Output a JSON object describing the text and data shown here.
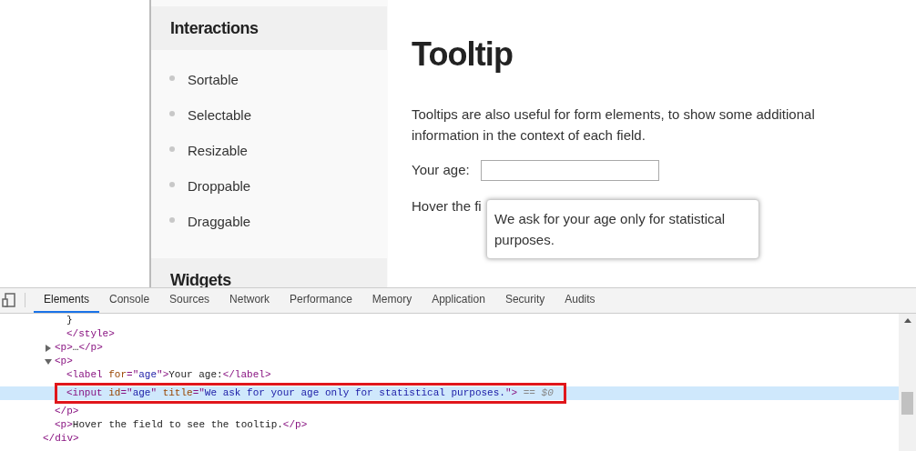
{
  "sidebar": {
    "sections": [
      {
        "title": "Interactions",
        "items": [
          "Sortable",
          "Selectable",
          "Resizable",
          "Droppable",
          "Draggable"
        ]
      },
      {
        "title": "Widgets"
      }
    ]
  },
  "content": {
    "title": "Tooltip",
    "intro": "Tooltips are also useful for form elements, to show some additional information in the context of each field.",
    "field_label": "Your age:",
    "hint": "Hover the fi",
    "tooltip": "We ask for your age only for statistical purposes."
  },
  "devtools": {
    "tabs": [
      {
        "label": "Elements",
        "selected": true
      },
      {
        "label": "Console",
        "selected": false
      },
      {
        "label": "Sources",
        "selected": false
      },
      {
        "label": "Network",
        "selected": false
      },
      {
        "label": "Performance",
        "selected": false
      },
      {
        "label": "Memory",
        "selected": false
      },
      {
        "label": "Application",
        "selected": false
      },
      {
        "label": "Security",
        "selected": false
      },
      {
        "label": "Audits",
        "selected": false
      }
    ],
    "tree": [
      {
        "children": [
          {
            "children": [
              {
                "children": [
                  {
                    "selected": false,
                    "tokens": [
                      {
                        "kind": "text",
                        "text": "}"
                      }
                    ]
                  },
                  {
                    "selected": false,
                    "tokens": [
                      {
                        "kind": "tag",
                        "text": "</style>"
                      }
                    ]
                  }
                ]
              },
              {
                "selected": false,
                "expanded": false,
                "tokens": [
                  {
                    "kind": "tag",
                    "text": "<p>"
                  },
                  {
                    "kind": "text",
                    "text": "…"
                  },
                  {
                    "kind": "tag",
                    "text": "</p>"
                  }
                ]
              },
              {
                "selected": false,
                "expanded": true,
                "tokens": [
                  {
                    "kind": "tag",
                    "text": "<p>"
                  }
                ],
                "children": [
                  {
                    "selected": false,
                    "tokens": [
                      {
                        "kind": "tag",
                        "text": "<label "
                      },
                      {
                        "kind": "attr",
                        "text": "for"
                      },
                      {
                        "kind": "tag",
                        "text": "=\""
                      },
                      {
                        "kind": "value",
                        "text": "age"
                      },
                      {
                        "kind": "tag",
                        "text": "\">"
                      },
                      {
                        "kind": "text",
                        "text": "Your age:"
                      },
                      {
                        "kind": "tag",
                        "text": "</label>"
                      }
                    ]
                  },
                  {
                    "selected": true,
                    "tokens": [
                      {
                        "kind": "tag",
                        "text": "<input "
                      },
                      {
                        "kind": "attr",
                        "text": "id"
                      },
                      {
                        "kind": "tag",
                        "text": "=\""
                      },
                      {
                        "kind": "value",
                        "text": "age"
                      },
                      {
                        "kind": "tag",
                        "text": "\" "
                      },
                      {
                        "kind": "attr",
                        "text": "title"
                      },
                      {
                        "kind": "tag",
                        "text": "=\""
                      },
                      {
                        "kind": "value",
                        "text": "We ask for your age only for statistical purposes."
                      },
                      {
                        "kind": "tag",
                        "text": "\">"
                      },
                      {
                        "kind": "ref",
                        "text": " == $0"
                      }
                    ]
                  }
                ],
                "end": [
                  {
                    "kind": "tag",
                    "text": "</p>"
                  }
                ]
              },
              {
                "selected": false,
                "tokens": [
                  {
                    "kind": "tag",
                    "text": "<p>"
                  },
                  {
                    "kind": "text",
                    "text": "Hover the field to see the tooltip."
                  },
                  {
                    "kind": "tag",
                    "text": "</p>"
                  }
                ]
              }
            ],
            "end": [
              {
                "kind": "tag",
                "text": "</div>"
              }
            ]
          }
        ]
      }
    ]
  }
}
